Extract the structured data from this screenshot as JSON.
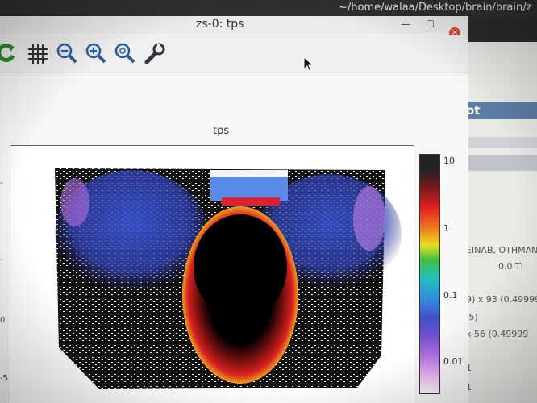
{
  "desktop": {
    "path_text": "~/home/walaa/Desktop/brain/brain/z"
  },
  "window": {
    "title": "zs-0: tps",
    "minimize_label": "—",
    "maximize_label": "☐",
    "close_label": "×"
  },
  "toolbar": {
    "tools": [
      "refresh-icon",
      "grid-icon",
      "zoom-out-icon",
      "zoom-in-icon",
      "zoom-reset-icon",
      "wrench-icon"
    ]
  },
  "plot": {
    "title": "tps",
    "colorbar_labels": [
      "10",
      "1",
      "0.1",
      "0.01"
    ],
    "y_tick_labels": [
      "-",
      "-",
      "0",
      "-5"
    ]
  },
  "background_window": {
    "header_fragment": "ot",
    "texts": [
      "EINAB, OTHMAN",
      "0.0 TI",
      "9) x 93 (0.49999",
      ".5)",
      "x 56 (0.49999",
      "1",
      "1"
    ]
  },
  "chart_data": {
    "type": "heatmap",
    "title": "tps",
    "colorbar": {
      "scale": "log",
      "ticks": [
        10,
        1,
        0.1,
        0.01
      ]
    }
  }
}
